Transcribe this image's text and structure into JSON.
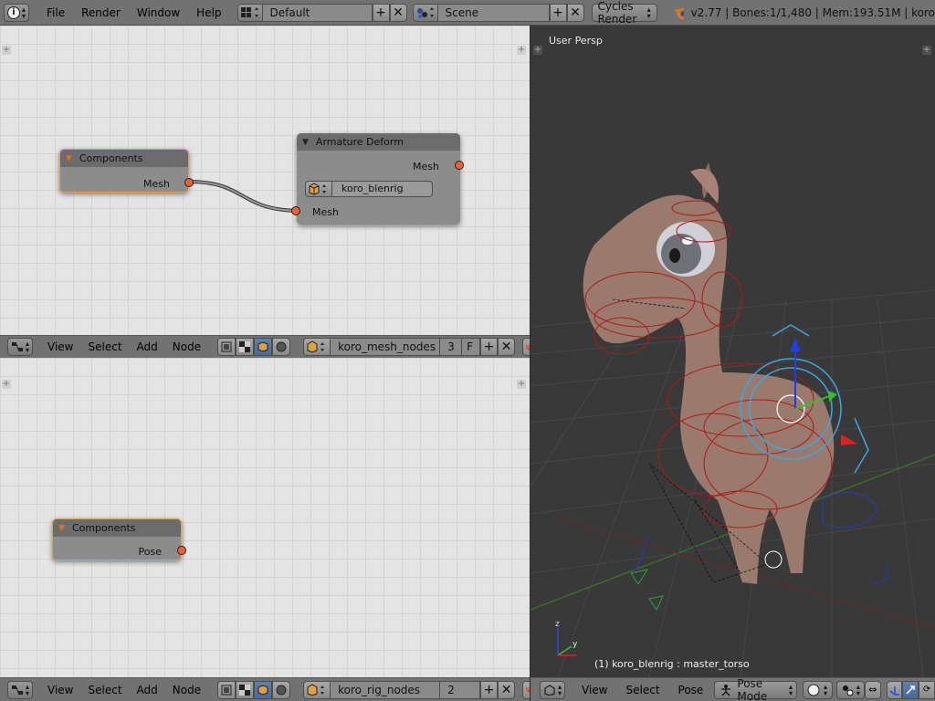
{
  "info_header": {
    "editor_type_icon": "info-icon",
    "menus": [
      "File",
      "Render",
      "Window",
      "Help"
    ],
    "screen_layout": "Default",
    "scene": "Scene",
    "render_engine": "Cycles Render",
    "stats": "v2.77 | Bones:1/1,480  | Mem:193.51M | koro"
  },
  "node_editor_top": {
    "nodes": {
      "components": {
        "title": "Components",
        "output": "Mesh"
      },
      "armature_deform": {
        "title": "Armature Deform",
        "output": "Mesh",
        "object": "koro_blenrig",
        "input": "Mesh"
      }
    },
    "header": {
      "menus": [
        "View",
        "Select",
        "Add",
        "Node"
      ],
      "node_tree": "koro_mesh_nodes",
      "users": "3",
      "fake_user": "F"
    }
  },
  "node_editor_bottom": {
    "nodes": {
      "components": {
        "title": "Components",
        "output": "Pose"
      }
    },
    "header": {
      "menus": [
        "View",
        "Select",
        "Add",
        "Node"
      ],
      "node_tree": "koro_rig_nodes",
      "users": "2"
    }
  },
  "viewport": {
    "view_label": "User Persp",
    "status": "(1) koro_blenrig : master_torso",
    "header": {
      "menus": [
        "View",
        "Select",
        "Pose"
      ],
      "mode": "Pose Mode"
    },
    "colors": {
      "background": "#393939",
      "grid": "#4a4a4a",
      "x_axis": "#a03030",
      "y_axis": "#60a030",
      "bones": "#b01818",
      "widget": "#40a8e0"
    }
  }
}
